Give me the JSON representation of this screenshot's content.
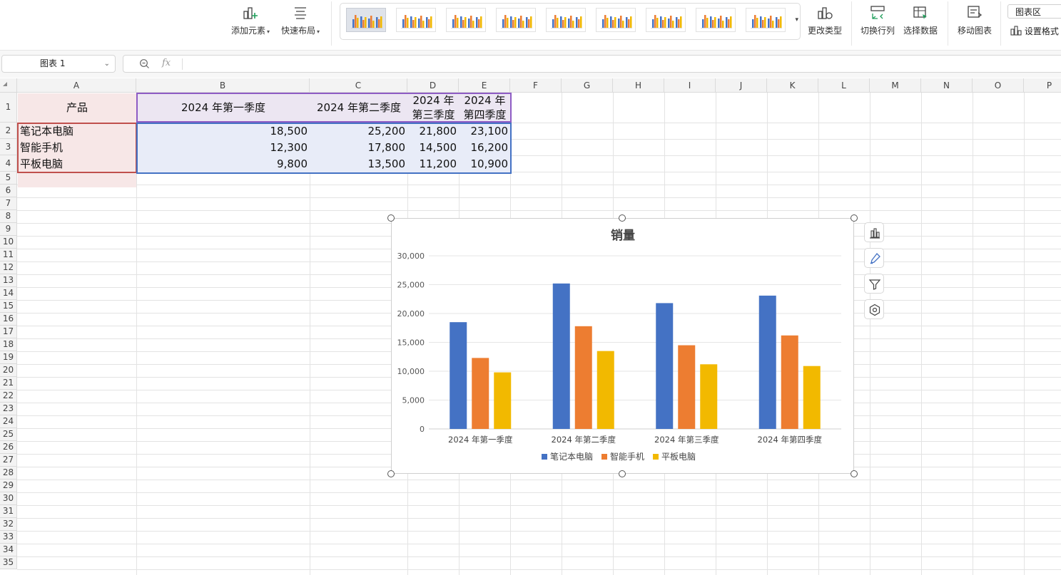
{
  "ribbon": {
    "add_element": "添加元素",
    "quick_layout": "快速布局",
    "change_type": "更改类型",
    "switch_row_col": "切换行列",
    "select_data": "选择数据",
    "move_chart": "移动图表",
    "chart_area": "图表区",
    "set_format": "设置格式",
    "style_count": 9,
    "selected_style": 1
  },
  "formula_bar": {
    "name_box": "图表 1",
    "fx": "fx",
    "formula": ""
  },
  "sheet": {
    "columns": [
      "A",
      "B",
      "C",
      "D",
      "E",
      "F",
      "G",
      "H",
      "I",
      "J",
      "K",
      "L",
      "M",
      "N",
      "O",
      "P"
    ],
    "rows": [
      "1",
      "2",
      "3",
      "4",
      "5",
      "6",
      "7",
      "8",
      "9",
      "10",
      "11",
      "12",
      "13",
      "14",
      "15",
      "16",
      "17",
      "18",
      "19",
      "20",
      "21",
      "22",
      "23",
      "24",
      "25",
      "26",
      "27",
      "28",
      "29",
      "30",
      "31",
      "32",
      "33",
      "34",
      "35"
    ],
    "header": {
      "product": "产品",
      "q1": "2024 年第一季度",
      "q2": "2024 年第二季度",
      "q3_line1": "2024 年",
      "q3_line2": "第三季度",
      "q4_line1": "2024 年",
      "q4_line2": "第四季度"
    },
    "data_rows": [
      {
        "product": "笔记本电脑",
        "q1": "18,500",
        "q2": "25,200",
        "q3": "21,800",
        "q4": "23,100"
      },
      {
        "product": "智能手机",
        "q1": "12,300",
        "q2": "17,800",
        "q3": "14,500",
        "q4": "16,200"
      },
      {
        "product": "平板电脑",
        "q1": "9,800",
        "q2": "13,500",
        "q3": "11,200",
        "q4": "10,900"
      }
    ]
  },
  "chart_data": {
    "type": "bar",
    "title": "销量",
    "categories": [
      "2024 年第一季度",
      "2024 年第二季度",
      "2024 年第三季度",
      "2024 年第四季度"
    ],
    "series": [
      {
        "name": "笔记本电脑",
        "values": [
          18500,
          25200,
          21800,
          23100
        ],
        "color": "#4472C4"
      },
      {
        "name": "智能手机",
        "values": [
          12300,
          17800,
          14500,
          16200
        ],
        "color": "#ED7D31"
      },
      {
        "name": "平板电脑",
        "values": [
          9800,
          13500,
          11200,
          10900
        ],
        "color": "#F2B900"
      }
    ],
    "ylim": [
      0,
      30000
    ],
    "yticks": [
      "0",
      "5,000",
      "10,000",
      "15,000",
      "20,000",
      "25,000",
      "30,000"
    ],
    "grid": true,
    "legend": "bottom",
    "xlabel": "",
    "ylabel": ""
  },
  "chart_tools": [
    "chart-elements-icon",
    "chart-style-icon",
    "chart-filter-icon",
    "chart-settings-icon"
  ]
}
